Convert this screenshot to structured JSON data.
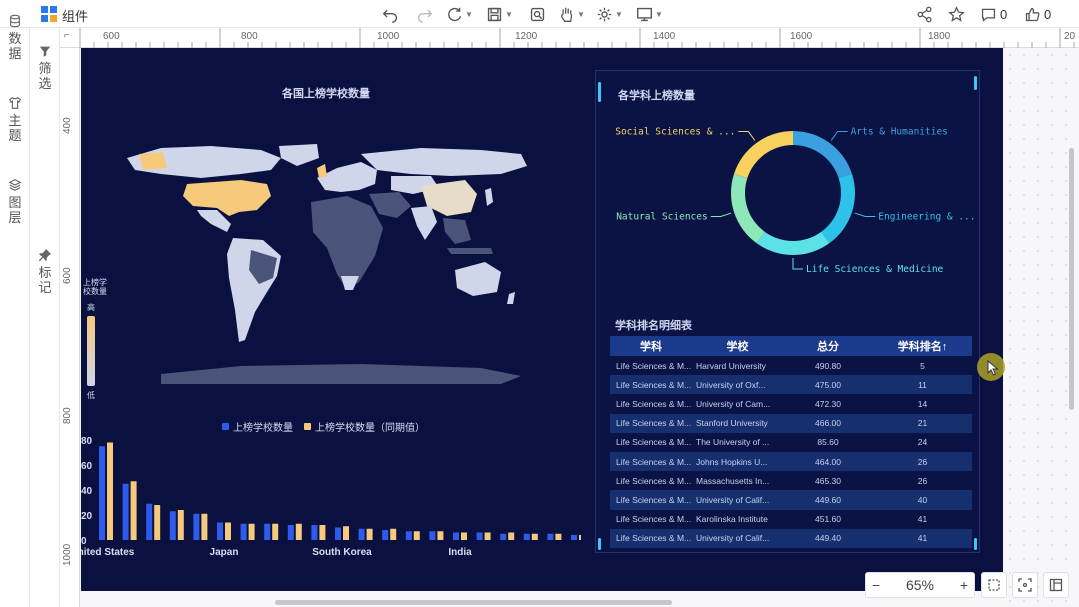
{
  "app": {
    "title": "组件"
  },
  "toolbar": {
    "comment_count": "0",
    "like_count": "0"
  },
  "side_tabs": [
    {
      "label": "数据"
    },
    {
      "label": "主题"
    },
    {
      "label": "图层"
    }
  ],
  "side_tabs2": [
    {
      "label": "筛选"
    },
    {
      "label": "标记"
    }
  ],
  "ruler": {
    "h_ticks": [
      "600",
      "800",
      "1000",
      "1200",
      "1400",
      "1600",
      "1800",
      "20"
    ],
    "v_ticks": [
      "400",
      "600",
      "800",
      "1000"
    ]
  },
  "zoom": {
    "minus": "−",
    "value": "65%",
    "plus": "+"
  },
  "map_panel": {
    "title": "各国上榜学校数量",
    "legend_title": "上榜学校数量",
    "legend_high": "高",
    "legend_low": "低"
  },
  "bar_panel": {
    "legend": [
      "上榜学校数量",
      "上榜学校数量（同期值）"
    ]
  },
  "donut_panel": {
    "title": "各学科上榜数量"
  },
  "table_panel": {
    "title": "学科排名明细表",
    "headers": [
      "学科",
      "学校",
      "总分",
      "学科排名↑"
    ],
    "rows": [
      [
        "Life Sciences & M...",
        "Harvard University",
        "490.80",
        "5"
      ],
      [
        "Life Sciences & M...",
        "University of Oxf...",
        "475.00",
        "11"
      ],
      [
        "Life Sciences & M...",
        "University of Cam...",
        "472.30",
        "14"
      ],
      [
        "Life Sciences & M...",
        "Stanford University",
        "466.00",
        "21"
      ],
      [
        "Life Sciences & M...",
        "The University of ...",
        "85.60",
        "24"
      ],
      [
        "Life Sciences & M...",
        "Johns Hopkins U...",
        "464.00",
        "26"
      ],
      [
        "Life Sciences & M...",
        "Massachusetts In...",
        "465.30",
        "26"
      ],
      [
        "Life Sciences & M...",
        "University of Calif...",
        "449.60",
        "40"
      ],
      [
        "Life Sciences & M...",
        "Karolinska Institute",
        "451.60",
        "41"
      ],
      [
        "Life Sciences & M...",
        "University of Calif...",
        "449.40",
        "41"
      ]
    ]
  },
  "colors": {
    "canvas_bg": "#0a1140",
    "bar_primary": "#2f5bea",
    "bar_compare": "#f6c97b",
    "map_high": "#f6c97b",
    "map_low": "#cfd6ea",
    "map_none": "#4a5378"
  },
  "chart_data": [
    {
      "type": "bar",
      "title": "",
      "categories": [
        "United States",
        "",
        "",
        "",
        "",
        "Japan",
        "",
        "",
        "",
        "",
        "South Korea",
        "",
        "",
        "",
        "",
        "India",
        "",
        "",
        "",
        "",
        ""
      ],
      "tick_labels_shown": [
        "nited States",
        "Japan",
        "South Korea",
        "India"
      ],
      "series": [
        {
          "name": "上榜学校数量",
          "values": [
            75,
            45,
            29,
            23,
            21,
            14,
            13,
            13,
            12,
            12,
            10,
            9,
            8,
            7,
            7,
            6,
            6,
            5,
            5,
            5,
            4
          ]
        },
        {
          "name": "上榜学校数量（同期值）",
          "values": [
            78,
            47,
            28,
            24,
            21,
            14,
            13,
            13,
            13,
            12,
            11,
            9,
            9,
            7,
            7,
            6,
            6,
            6,
            5,
            5,
            4
          ]
        }
      ],
      "y_ticks": [
        "0",
        "20",
        "40",
        "60",
        "80"
      ],
      "ylim": [
        0,
        80
      ]
    },
    {
      "type": "pie",
      "title": "各学科上榜数量",
      "labels": [
        "Arts & Humanities",
        "Engineering & ...",
        "Life Sciences & Medicine",
        "Natural Sciences",
        "Social Sciences & ..."
      ],
      "values": [
        20,
        20,
        20,
        20,
        20
      ],
      "colors": [
        "#3aa0e0",
        "#2ec2e8",
        "#5ce1e6",
        "#8ce8b8",
        "#f8d25e"
      ]
    }
  ]
}
